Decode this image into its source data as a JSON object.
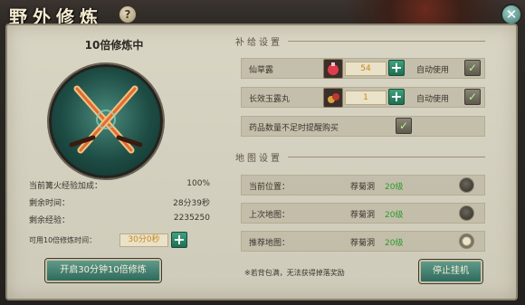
{
  "window": {
    "title": "野外修炼",
    "help_icon": "question-icon",
    "close_icon": "close-icon"
  },
  "left": {
    "mode_title": "10倍修炼中",
    "stats": [
      {
        "label": "当前篝火经验加成：",
        "value": "100%"
      },
      {
        "label": "剩余时间：",
        "value": "28分39秒"
      },
      {
        "label": "剩余经验：",
        "value": "2235250"
      }
    ],
    "available_label": "可用10倍修炼时间：",
    "available_value": "30分0秒",
    "start_button": "开启30分钟10倍修炼"
  },
  "supply": {
    "title": "补给设置",
    "items": [
      {
        "name": "仙草露",
        "qty": "54",
        "auto_label": "自动使用",
        "icon": "potion-icon"
      },
      {
        "name": "长效玉露丸",
        "qty": "1",
        "auto_label": "自动使用",
        "icon": "pill-icon"
      }
    ],
    "remind_label": "药品数量不足时提醒购买"
  },
  "map": {
    "title": "地图设置",
    "rows": [
      {
        "label": "当前位置：",
        "place": "荐菊洞",
        "level": "20级",
        "selected": false
      },
      {
        "label": "上次地图：",
        "place": "荐菊洞",
        "level": "20级",
        "selected": false
      },
      {
        "label": "推荐地图：",
        "place": "荐菊洞",
        "level": "20级",
        "selected": true
      }
    ]
  },
  "footer": {
    "note": "※若背包满，无法获得掉落奖励",
    "stop_button": "停止挂机"
  },
  "colors": {
    "accent_green": "#2f6a5d",
    "level_green": "#2a9a2a",
    "value_orange": "#c8871a"
  }
}
